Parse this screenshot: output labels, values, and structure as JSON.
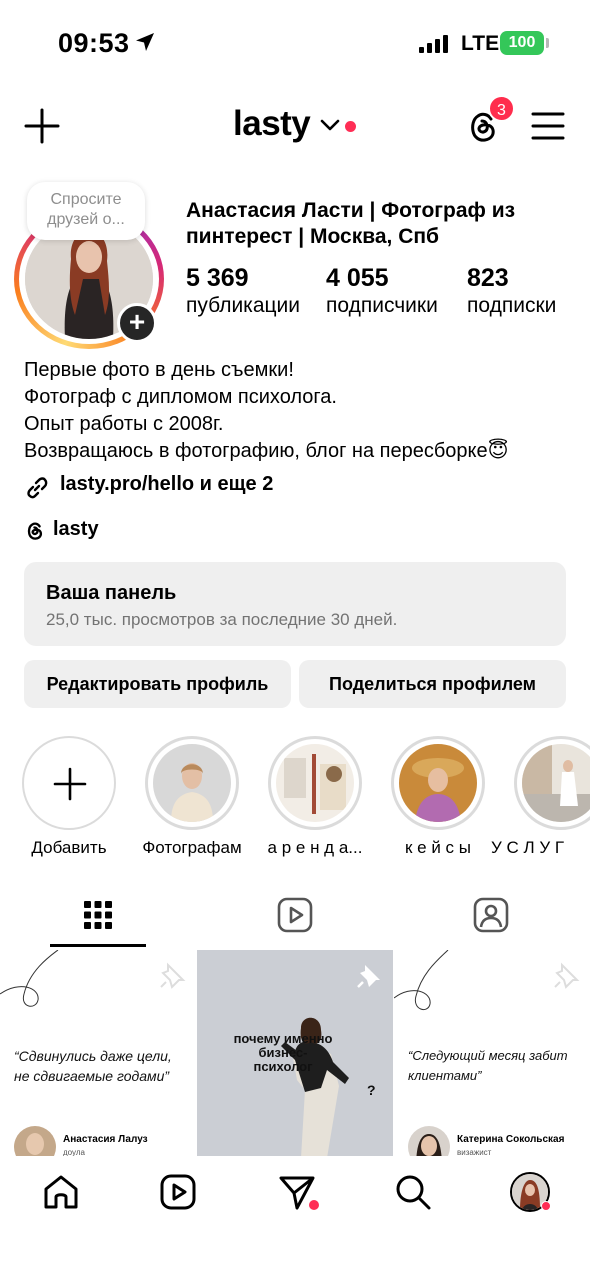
{
  "status_bar": {
    "time": "09:53",
    "network": "LTE",
    "battery": "100",
    "battery_color": "#34c759"
  },
  "header": {
    "username": "lasty",
    "threads_badge": "3",
    "accent_dot_color": "#ff2d55",
    "icons": [
      "plus-icon",
      "chevron-down-icon",
      "threads-icon",
      "menu-icon"
    ]
  },
  "profile": {
    "bubble_note": "Спросите друзей о...",
    "display_name": "Анастасия Ласти | Фотограф из пинтерест | Москва, Спб",
    "stats": [
      {
        "value": "5 369",
        "label": "публикации"
      },
      {
        "value": "4 055",
        "label": "подписчики"
      },
      {
        "value": "823",
        "label": "подписки"
      }
    ],
    "bio": [
      "Первые фото в день съемки!",
      "Фотограф с дипломом психолога.",
      "Опыт работы с 2008г.",
      "Возвращаюсь в фотографию, блог на пересборке😇"
    ],
    "link": "lasty.pro/hello и еще 2",
    "threads_handle": "lasty"
  },
  "dashboard": {
    "title": "Ваша панель",
    "subtitle": "25,0 тыс. просмотров за последние 30 дней."
  },
  "buttons": {
    "edit_profile": "Редактировать профиль",
    "share_profile": "Поделиться профилем"
  },
  "highlights": [
    {
      "label": "Добавить"
    },
    {
      "label": "Фотографам"
    },
    {
      "label": "а р е н д а..."
    },
    {
      "label": "к е й с ы"
    },
    {
      "label": "У С Л У Г"
    }
  ],
  "tabs": [
    "grid-icon",
    "reels-icon",
    "tagged-icon"
  ],
  "posts": [
    {
      "quote": "“Сдвинулись даже цели, не сдвигаемые годами”",
      "author": "Анастасия Лалуз",
      "role": "доула"
    },
    {
      "title": "почему именно бизнес-психолог",
      "mark": "?"
    },
    {
      "quote": "“Следующий месяц забит клиентами”",
      "author": "Катерина Сокольская",
      "role": "визажист"
    }
  ],
  "bottom_nav": [
    "home-icon",
    "reels-icon",
    "direct-icon",
    "search-icon",
    "profile-avatar"
  ]
}
